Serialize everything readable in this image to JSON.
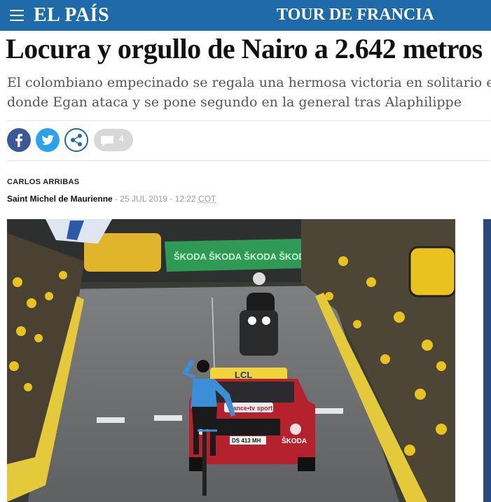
{
  "header": {
    "logo": "EL PAÍS",
    "section": "TOUR DE FRANCIA"
  },
  "article": {
    "headline": "Locura y orgullo de Nairo a 2.642 metros",
    "subtitle_line1": "El colombiano empecinado se regala una hermosa victoria en solitario en la cima",
    "subtitle_line2": "donde Egan ataca y se pone segundo en la general tras Alaphilippe",
    "author": "CARLOS ARRIBAS",
    "place": "Saint Michel de Maurienne",
    "separator": " - ",
    "date": "25 JUL 2019 - 12:22",
    "timezone": "COT"
  },
  "share": {
    "comment_count": "4",
    "icons": [
      "facebook-icon",
      "twitter-icon",
      "share-icon",
      "comment-icon"
    ]
  },
  "photo": {
    "car_banner": "LCL",
    "car_brand": "ŠKODA",
    "car_sticker": "france•tv sport",
    "plate": "DS 413 MH",
    "barrier_text": "ŠKODA ŠKODA ŠKODA ŠKODA"
  },
  "colors": {
    "brand_blue": "#1f6aa8",
    "facebook": "#3b5998",
    "twitter": "#2aa3ef"
  }
}
